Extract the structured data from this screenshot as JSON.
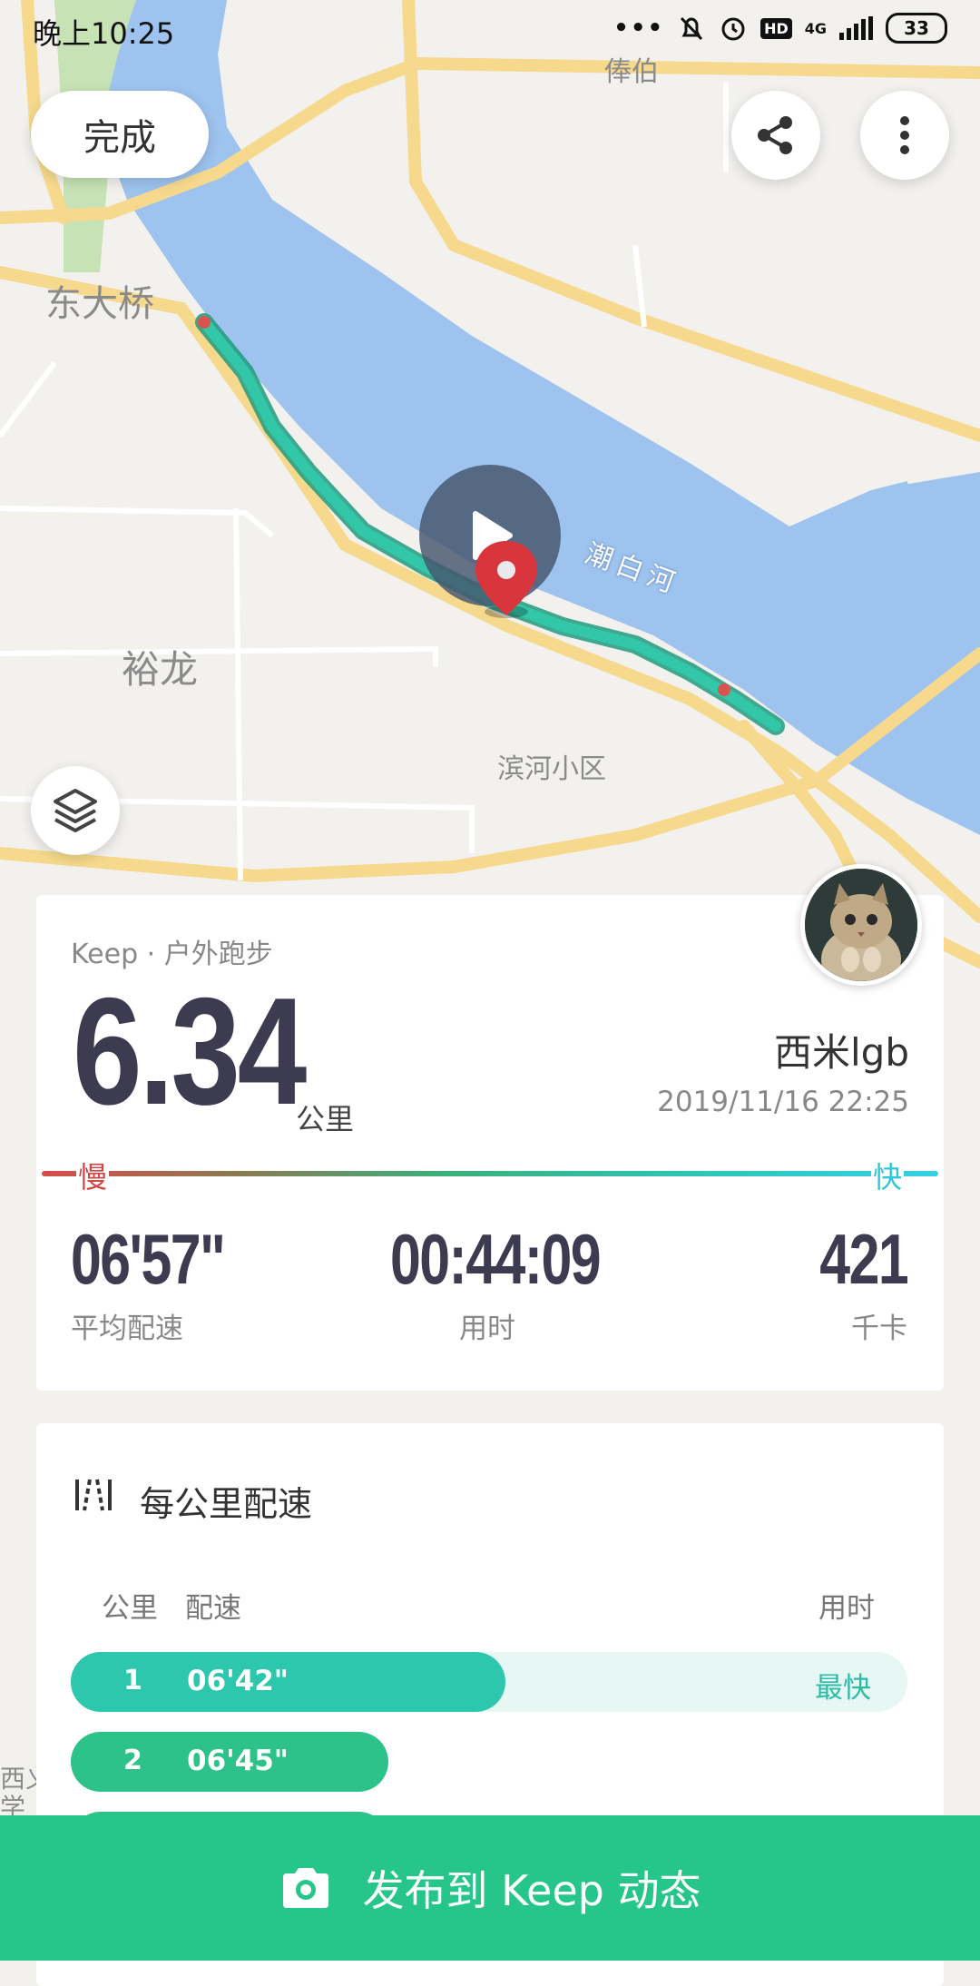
{
  "status_bar": {
    "time": "晚上10:25",
    "network": "4G",
    "battery": "33",
    "hd": "HD"
  },
  "top": {
    "done_label": "完成"
  },
  "map": {
    "labels": {
      "place_1": "东大桥",
      "place_2": "裕龙",
      "place_3": "滨河小区",
      "place_4": "俸伯",
      "river": "潮白河",
      "edge_1": "西义",
      "edge_2": "学"
    }
  },
  "summary": {
    "activity_type": "Keep · 户外跑步",
    "distance": "6.34",
    "distance_unit": "公里",
    "user_name": "西米lgb",
    "date": "2019/11/16 22:25",
    "pace_slow": "慢",
    "pace_fast": "快",
    "stats": [
      {
        "value": "06'57\"",
        "label": "平均配速"
      },
      {
        "value": "00:44:09",
        "label": "用时"
      },
      {
        "value": "421",
        "label": "千卡"
      }
    ]
  },
  "splits": {
    "title": "每公里配速",
    "col_km": "公里",
    "col_pace": "配速",
    "col_time": "用时",
    "rows": [
      {
        "km": "1",
        "pace": "06'42\"",
        "tag": "最快",
        "fill": 0.52,
        "color": "#2cc7ad"
      },
      {
        "km": "2",
        "pace": "06'45\"",
        "tag": "",
        "fill": 0.38,
        "color": "#2cc28a"
      }
    ]
  },
  "publish": {
    "label": "发布到 Keep 动态"
  },
  "colors": {
    "accent": "#26c68a",
    "teal": "#2cc7ad",
    "text_dark": "#3d3b4f"
  }
}
